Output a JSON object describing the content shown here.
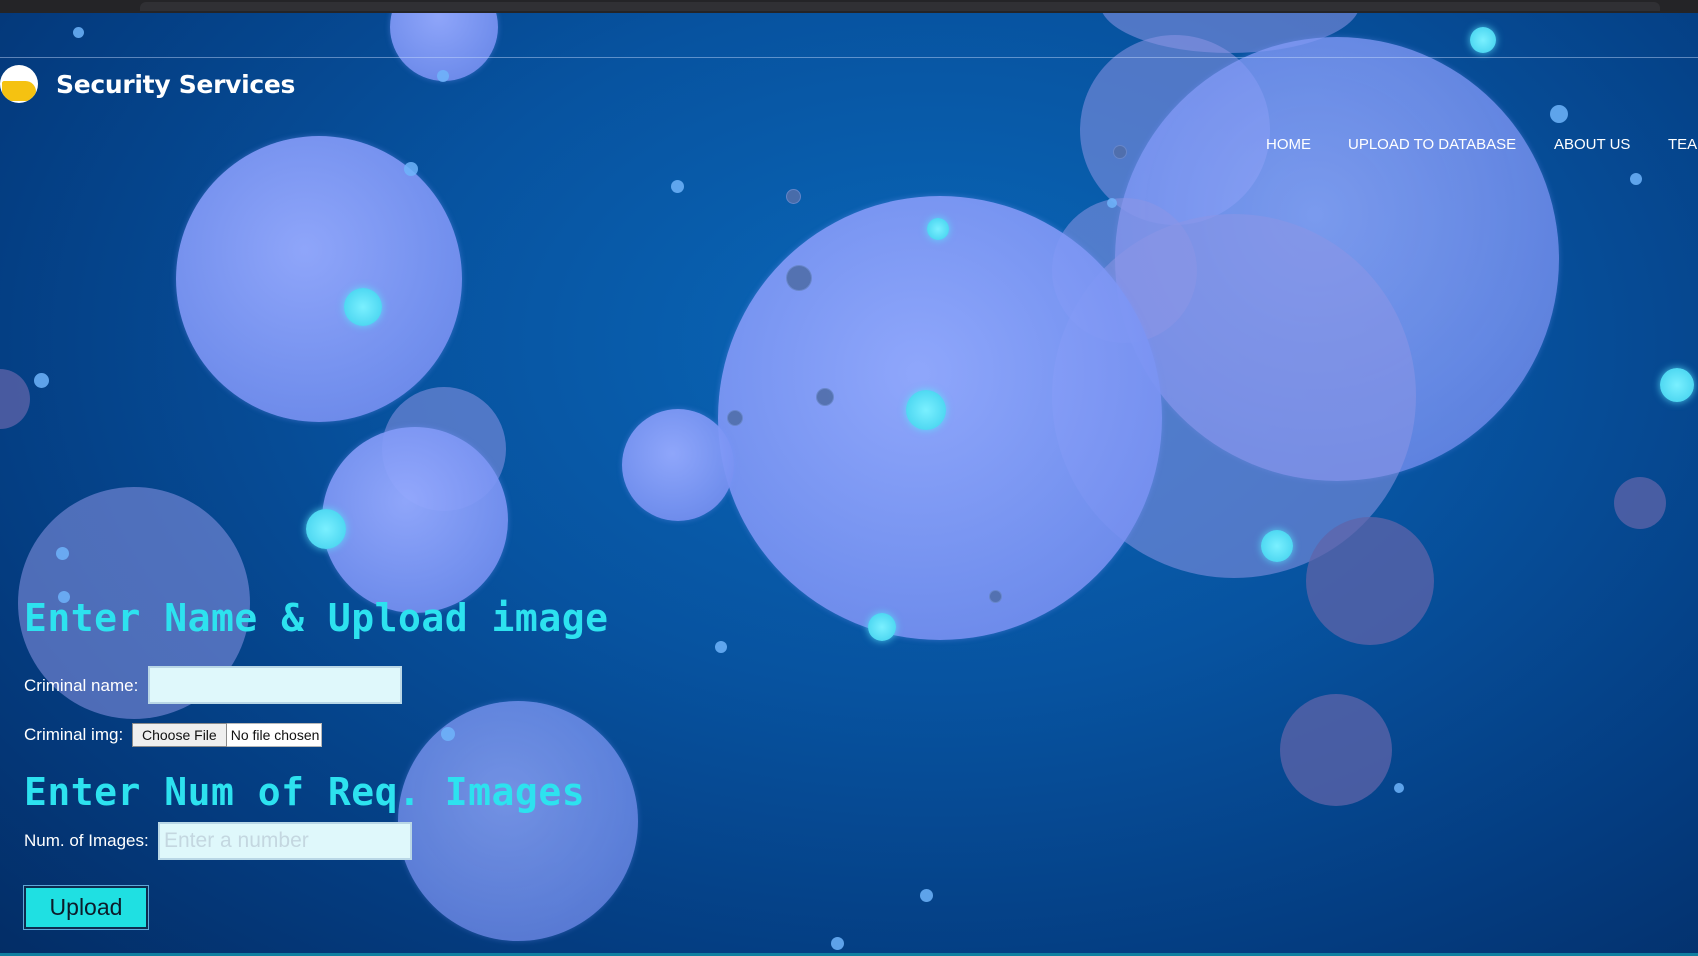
{
  "brand": {
    "name": "Security Services",
    "logo_icon": "half-sun-logo-icon"
  },
  "nav": {
    "items": [
      {
        "label": "HOME"
      },
      {
        "label": "UPLOAD TO DATABASE"
      },
      {
        "label": "ABOUT US"
      },
      {
        "label": "TEA"
      }
    ]
  },
  "form": {
    "heading_upload": "Enter Name & Upload image",
    "criminal_name_label": "Criminal name:",
    "criminal_name_value": "",
    "criminal_img_label": "Criminal img:",
    "choose_file_label": "Choose File",
    "no_file_text": "No file chosen",
    "heading_num": "Enter Num of Req. Images",
    "num_images_label": "Num. of Images:",
    "num_images_placeholder": "Enter a number",
    "upload_button": "Upload"
  },
  "colors": {
    "heading": "#2de2ef",
    "upload_button": "#1fe0e2",
    "background": "#0753a0"
  }
}
